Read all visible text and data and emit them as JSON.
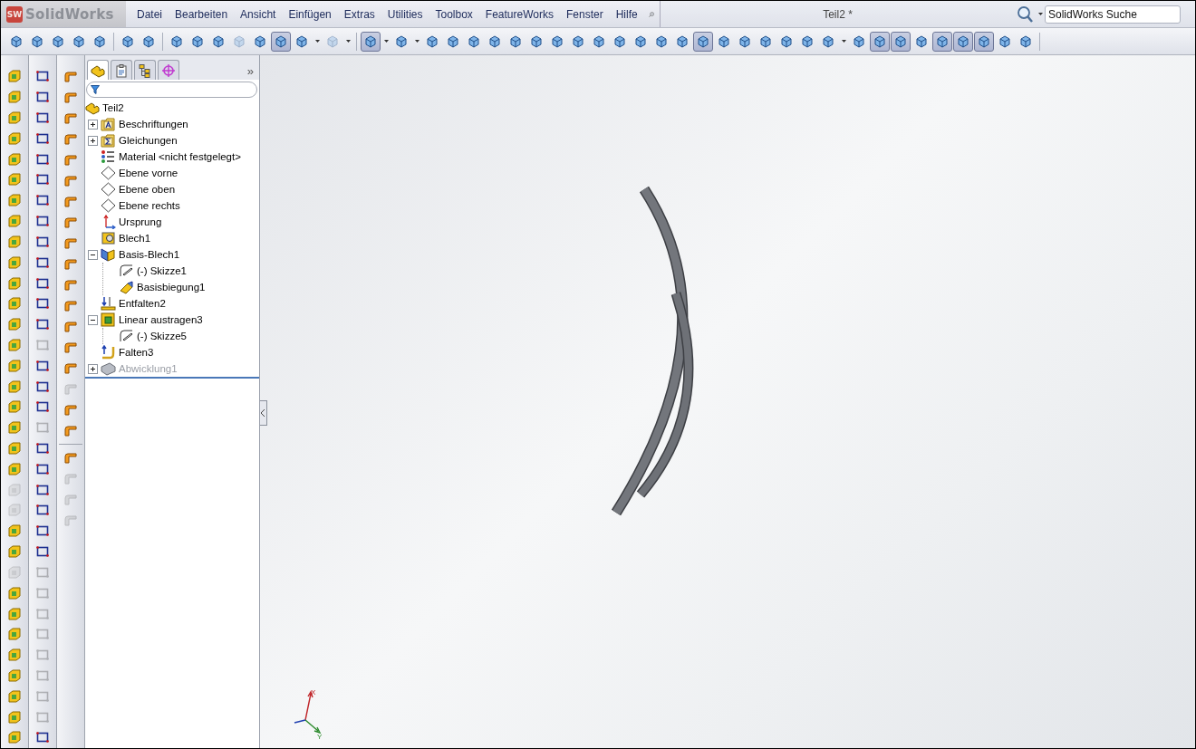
{
  "app": {
    "logo_badge": "SW",
    "logo": "SolidWorks",
    "menus": [
      "Datei",
      "Bearbeiten",
      "Ansicht",
      "Einfügen",
      "Extras",
      "Utilities",
      "Toolbox",
      "FeatureWorks",
      "Fenster",
      "Hilfe"
    ],
    "document_title": "Teil2 *",
    "search": {
      "placeholder": "SolidWorks Suche"
    }
  },
  "toolbar": {
    "items": [
      {
        "kind": "button",
        "pressed": false,
        "disabled": false
      },
      {
        "kind": "button",
        "pressed": false,
        "disabled": false
      },
      {
        "kind": "button",
        "pressed": false,
        "disabled": false
      },
      {
        "kind": "button",
        "pressed": false,
        "disabled": false
      },
      {
        "kind": "button",
        "pressed": false,
        "disabled": false
      },
      {
        "kind": "separator"
      },
      {
        "kind": "button",
        "pressed": false,
        "disabled": false
      },
      {
        "kind": "button",
        "pressed": false,
        "disabled": false
      },
      {
        "kind": "separator"
      },
      {
        "kind": "button",
        "pressed": false,
        "disabled": false
      },
      {
        "kind": "button",
        "pressed": false,
        "disabled": false
      },
      {
        "kind": "button",
        "pressed": false,
        "disabled": false
      },
      {
        "kind": "button",
        "pressed": false,
        "disabled": true
      },
      {
        "kind": "button",
        "pressed": false,
        "disabled": false
      },
      {
        "kind": "button",
        "pressed": true,
        "disabled": false
      },
      {
        "kind": "button",
        "pressed": false,
        "disabled": false
      },
      {
        "kind": "dropdown"
      },
      {
        "kind": "button",
        "pressed": false,
        "disabled": true
      },
      {
        "kind": "dropdown"
      },
      {
        "kind": "separator"
      },
      {
        "kind": "button",
        "pressed": true,
        "disabled": false
      },
      {
        "kind": "dropdown"
      },
      {
        "kind": "button",
        "pressed": false,
        "disabled": false
      },
      {
        "kind": "dropdown"
      },
      {
        "kind": "button",
        "pressed": false,
        "disabled": false
      },
      {
        "kind": "button",
        "pressed": false,
        "disabled": false
      },
      {
        "kind": "button",
        "pressed": false,
        "disabled": false
      },
      {
        "kind": "button",
        "pressed": false,
        "disabled": false
      },
      {
        "kind": "button",
        "pressed": false,
        "disabled": false
      },
      {
        "kind": "button",
        "pressed": false,
        "disabled": false
      },
      {
        "kind": "button",
        "pressed": false,
        "disabled": false
      },
      {
        "kind": "button",
        "pressed": false,
        "disabled": false
      },
      {
        "kind": "button",
        "pressed": false,
        "disabled": false
      },
      {
        "kind": "button",
        "pressed": false,
        "disabled": false
      },
      {
        "kind": "button",
        "pressed": false,
        "disabled": false
      },
      {
        "kind": "button",
        "pressed": false,
        "disabled": false
      },
      {
        "kind": "button",
        "pressed": false,
        "disabled": false
      },
      {
        "kind": "button",
        "pressed": true,
        "disabled": false
      },
      {
        "kind": "button",
        "pressed": false,
        "disabled": false
      },
      {
        "kind": "button",
        "pressed": false,
        "disabled": false
      },
      {
        "kind": "button",
        "pressed": false,
        "disabled": false
      },
      {
        "kind": "button",
        "pressed": false,
        "disabled": false
      },
      {
        "kind": "button",
        "pressed": false,
        "disabled": false
      },
      {
        "kind": "button",
        "pressed": false,
        "disabled": false
      },
      {
        "kind": "dropdown"
      },
      {
        "kind": "button",
        "pressed": false,
        "disabled": false
      },
      {
        "kind": "button",
        "pressed": true,
        "disabled": false
      },
      {
        "kind": "button",
        "pressed": true,
        "disabled": false
      },
      {
        "kind": "button",
        "pressed": false,
        "disabled": false
      },
      {
        "kind": "button",
        "pressed": true,
        "disabled": false
      },
      {
        "kind": "button",
        "pressed": true,
        "disabled": false
      },
      {
        "kind": "button",
        "pressed": true,
        "disabled": false
      },
      {
        "kind": "button",
        "pressed": false,
        "disabled": false
      },
      {
        "kind": "button",
        "pressed": false,
        "disabled": false
      },
      {
        "kind": "separator"
      }
    ]
  },
  "command_columns": [
    {
      "kind": "features",
      "items": [
        {
          "disabled": false
        },
        {
          "disabled": false
        },
        {
          "disabled": false
        },
        {
          "disabled": false
        },
        {
          "disabled": false
        },
        {
          "disabled": false
        },
        {
          "disabled": false
        },
        {
          "disabled": false
        },
        {
          "disabled": false
        },
        {
          "disabled": false
        },
        {
          "disabled": false
        },
        {
          "disabled": false
        },
        {
          "disabled": false
        },
        {
          "disabled": false
        },
        {
          "disabled": false
        },
        {
          "disabled": false
        },
        {
          "disabled": false
        },
        {
          "disabled": false
        },
        {
          "disabled": false
        },
        {
          "disabled": false
        },
        {
          "disabled": true
        },
        {
          "disabled": true
        },
        {
          "disabled": false
        },
        {
          "disabled": false
        },
        {
          "disabled": true
        },
        {
          "disabled": false
        },
        {
          "disabled": false
        },
        {
          "disabled": false
        },
        {
          "disabled": false
        },
        {
          "disabled": false
        },
        {
          "disabled": false
        },
        {
          "disabled": false
        },
        {
          "disabled": false
        }
      ]
    },
    {
      "kind": "sketch",
      "items": [
        {
          "disabled": false
        },
        {
          "disabled": false
        },
        {
          "disabled": false
        },
        {
          "disabled": false
        },
        {
          "disabled": false
        },
        {
          "disabled": false
        },
        {
          "disabled": false
        },
        {
          "disabled": false
        },
        {
          "disabled": false
        },
        {
          "disabled": false
        },
        {
          "disabled": false
        },
        {
          "disabled": false
        },
        {
          "disabled": false
        },
        {
          "disabled": true
        },
        {
          "disabled": false
        },
        {
          "disabled": false
        },
        {
          "disabled": false
        },
        {
          "disabled": true
        },
        {
          "disabled": false
        },
        {
          "disabled": false
        },
        {
          "disabled": false
        },
        {
          "disabled": false
        },
        {
          "disabled": false
        },
        {
          "disabled": false
        },
        {
          "disabled": true
        },
        {
          "disabled": true
        },
        {
          "disabled": true
        },
        {
          "disabled": true
        },
        {
          "disabled": true
        },
        {
          "disabled": true
        },
        {
          "disabled": true
        },
        {
          "disabled": true
        },
        {
          "disabled": false
        }
      ]
    },
    {
      "kind": "sheetmetal",
      "items": [
        {
          "disabled": false
        },
        {
          "disabled": false
        },
        {
          "disabled": false
        },
        {
          "disabled": false
        },
        {
          "disabled": false
        },
        {
          "disabled": false
        },
        {
          "disabled": false
        },
        {
          "disabled": false
        },
        {
          "disabled": false
        },
        {
          "disabled": false
        },
        {
          "disabled": false
        },
        {
          "disabled": false
        },
        {
          "disabled": false
        },
        {
          "disabled": false
        },
        {
          "disabled": false
        },
        {
          "disabled": true
        },
        {
          "disabled": false
        },
        {
          "disabled": false
        },
        {
          "separator": true
        },
        {
          "disabled": false
        },
        {
          "disabled": true
        },
        {
          "disabled": true
        },
        {
          "disabled": true
        }
      ]
    }
  ],
  "feature_manager": {
    "tabs": [
      {
        "kind": "tree",
        "selected": true
      },
      {
        "kind": "properties",
        "selected": false
      },
      {
        "kind": "configurations",
        "selected": false
      },
      {
        "kind": "display",
        "selected": false
      }
    ],
    "more": "»",
    "tree": {
      "label": "Teil2",
      "kind": "part",
      "disabled": false,
      "children": [
        {
          "label": "Beschriftungen",
          "kind": "annotations",
          "expanded": false,
          "disabled": false
        },
        {
          "label": "Gleichungen",
          "kind": "equations",
          "expanded": false,
          "disabled": false
        },
        {
          "label": "Material <nicht festgelegt>",
          "kind": "material",
          "disabled": false
        },
        {
          "label": "Ebene vorne",
          "kind": "plane",
          "disabled": false
        },
        {
          "label": "Ebene oben",
          "kind": "plane",
          "disabled": false
        },
        {
          "label": "Ebene rechts",
          "kind": "plane",
          "disabled": false
        },
        {
          "label": "Ursprung",
          "kind": "origin",
          "disabled": false
        },
        {
          "label": "Blech1",
          "kind": "sheetmetal",
          "disabled": false
        },
        {
          "label": "Basis-Blech1",
          "kind": "baseflange",
          "expanded": true,
          "disabled": false,
          "children": [
            {
              "label": "(-) Skizze1",
              "kind": "sketch",
              "disabled": false
            },
            {
              "label": "Basisbiegung1",
              "kind": "bend",
              "disabled": false
            }
          ]
        },
        {
          "label": "Entfalten2",
          "kind": "unfold",
          "disabled": false
        },
        {
          "label": "Linear austragen3",
          "kind": "extrude",
          "expanded": true,
          "disabled": false,
          "children": [
            {
              "label": "(-) Skizze5",
              "kind": "sketch",
              "disabled": false
            }
          ]
        },
        {
          "label": "Falten3",
          "kind": "fold",
          "disabled": false
        },
        {
          "label": "Abwicklung1",
          "kind": "flatpattern",
          "expanded": false,
          "disabled": true
        }
      ]
    }
  },
  "viewport": {
    "triad": {
      "x_label": "X",
      "y_label": "Y"
    }
  }
}
